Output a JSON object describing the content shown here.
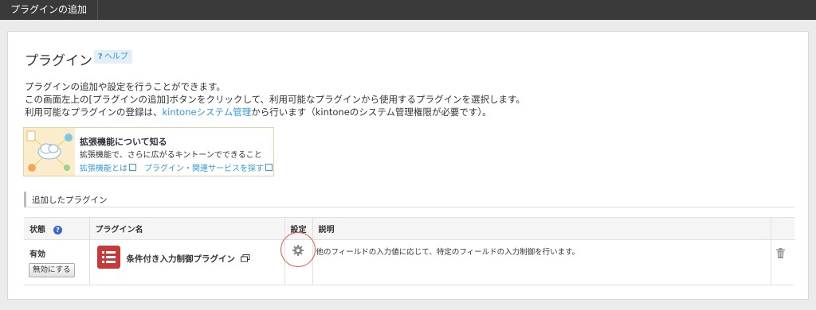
{
  "header": {
    "tab_label": "プラグインの追加"
  },
  "page": {
    "title": "プラグイン",
    "help": {
      "mark": "?",
      "label": "ヘルプ"
    },
    "desc_line1": "プラグインの追加や設定を行うことができます。",
    "desc_line2": "この画面左上の[プラグインの追加]ボタンをクリックして、利用可能なプラグインから使用するプラグインを選択します。",
    "desc_line3_pre": "利用可能なプラグインの登録は、",
    "desc_line3_link": "kintoneシステム管理",
    "desc_line3_post": "から行います（kintoneのシステム管理権限が必要です）。"
  },
  "promo": {
    "title": "拡張機能について知る",
    "subtitle": "拡張機能で、さらに広がるキントーンでできること",
    "link1": "拡張機能とは",
    "link2": "プラグイン・関連サービスを探す"
  },
  "section": {
    "label": "追加したプラグイン"
  },
  "table": {
    "headers": {
      "status": "状態",
      "status_help": "?",
      "name": "プラグイン名",
      "settings": "設定",
      "description": "説明"
    },
    "rows": [
      {
        "status": "有効",
        "disable_label": "無効にする",
        "name": "条件付き入力制御プラグイン",
        "description": "他のフィールドの入力値に応じて、特定のフィールドの入力制御を行います。"
      }
    ]
  },
  "colors": {
    "link": "#3498db",
    "plugin_icon": "#c83a3a",
    "highlight_circle": "#e2563c",
    "topbar": "#3a3a3a"
  },
  "icons": [
    "help-icon",
    "external-link-icon",
    "status-help-icon",
    "plugin-icon",
    "open-window-icon",
    "gear-icon",
    "trash-icon"
  ]
}
